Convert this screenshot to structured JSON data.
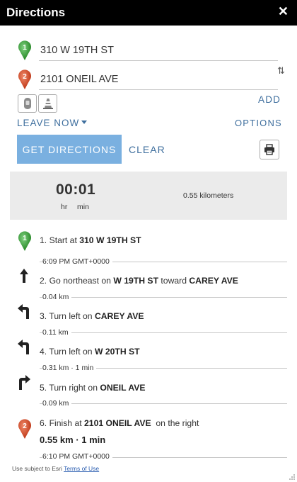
{
  "header": {
    "title": "Directions",
    "close_symbol": "✕"
  },
  "stops": [
    {
      "marker": "1",
      "value": "310 W 19TH ST",
      "color": "#3ca23c"
    },
    {
      "marker": "2",
      "value": "2101 ONEIL AVE",
      "color": "#d4502c"
    }
  ],
  "controls": {
    "swap_symbol": "⇅",
    "add_label": "ADD",
    "leave_label": "LEAVE NOW",
    "options_label": "OPTIONS",
    "get_directions_label": "GET DIRECTIONS",
    "clear_label": "CLEAR",
    "accent_color": "#3f6f9e",
    "button_color": "#7ab0e0"
  },
  "summary": {
    "time": "00:01",
    "hr_label": "hr",
    "min_label": "min",
    "distance": "0.55 kilometers"
  },
  "steps": [
    {
      "icon": "start-pin-icon",
      "num": "1.",
      "pre": "Start at ",
      "b1": "310 W 19TH ST",
      "mid": "",
      "b2": "",
      "post": "",
      "meta": "6:09 PM GMT+0000"
    },
    {
      "icon": "arrow-up-icon",
      "num": "2.",
      "pre": "Go northeast on ",
      "b1": "W 19TH ST",
      "mid": " toward ",
      "b2": "CAREY AVE",
      "post": "",
      "meta": "0.04 km"
    },
    {
      "icon": "turn-left-icon",
      "num": "3.",
      "pre": "Turn left on ",
      "b1": "CAREY AVE",
      "mid": "",
      "b2": "",
      "post": "",
      "meta": "0.11 km"
    },
    {
      "icon": "turn-left-icon",
      "num": "4.",
      "pre": "Turn left on ",
      "b1": "W 20TH ST",
      "mid": "",
      "b2": "",
      "post": "",
      "meta": "0.31 km · 1 min"
    },
    {
      "icon": "turn-right-icon",
      "num": "5.",
      "pre": "Turn right on ",
      "b1": "ONEIL AVE",
      "mid": "",
      "b2": "",
      "post": "",
      "meta": "0.09 km"
    },
    {
      "icon": "finish-pin-icon",
      "num": "6.",
      "pre": "Finish at ",
      "b1": "2101 ONEIL AVE",
      "mid": "  on the right",
      "b2": "",
      "post": "",
      "meta": "6:10 PM GMT+0000"
    }
  ],
  "final_total": "0.55 km · 1 min",
  "footer": {
    "text": "Use subject to Esri ",
    "link": "Terms of Use"
  }
}
